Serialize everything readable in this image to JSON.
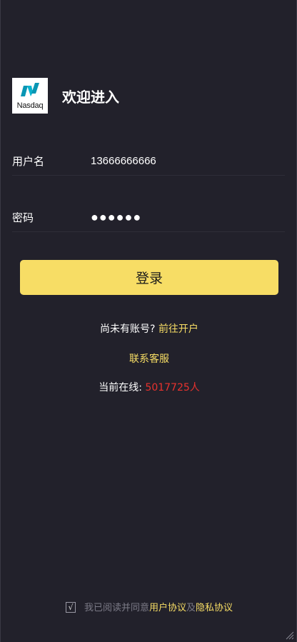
{
  "brand": {
    "logo_text": "Nasdaq",
    "welcome": "欢迎进入"
  },
  "form": {
    "username_label": "用户名",
    "username_value": "13666666666",
    "password_label": "密码",
    "password_value": "●●●●●●"
  },
  "login_button": "登录",
  "register": {
    "prompt": "尚未有账号?",
    "link": "前往开户"
  },
  "contact_link": "联系客服",
  "online": {
    "label": "当前在线:",
    "value": "5017725人"
  },
  "agreement": {
    "checkbox_mark": "√",
    "text": "我已阅读并同意",
    "user_agreement": "用户协议",
    "and": "及",
    "privacy_policy": "隐私协议"
  },
  "colors": {
    "background": "#22212b",
    "accent": "#f7dd65",
    "online_count": "#e8322e",
    "logo_mark": "#0996b4"
  },
  "icons": {
    "logo": "nasdaq-logo-icon",
    "resize": "resize-handle-icon"
  }
}
